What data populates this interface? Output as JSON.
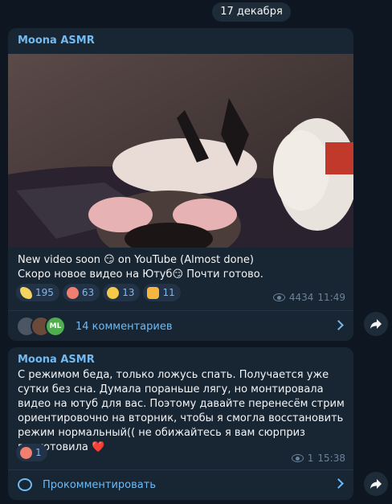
{
  "date_separator": "17 декабря",
  "messages": [
    {
      "author": "Moona ASMR",
      "text": "New video soon 😏 on YouTube (Almost done)\nСкоро новое видео на Ютуб😏 Почти готово.",
      "reactions": [
        {
          "icon": "banana-emoji",
          "count": "195"
        },
        {
          "icon": "heart-face-emoji",
          "count": "63"
        },
        {
          "icon": "grin-emoji",
          "count": "13"
        },
        {
          "icon": "ok-hand-emoji",
          "count": "11"
        }
      ],
      "views": "4434",
      "time": "11:49",
      "avatars": [
        "",
        "",
        "ML"
      ],
      "comments_label": "14 комментариев"
    },
    {
      "author": "Moona ASMR",
      "text": "С режимом беда, только ложусь спать. Получается уже сутки без сна. Думала пораньше лягу, но монтировала видео на ютуб для вас. Поэтому давайте перенесём стрим ориентировочно на вторник, чтобы я смогла восстановить режим нормальный(( не обижайтесь я вам сюрприз приготовила ❤️",
      "reactions": [
        {
          "icon": "heart-face-emoji",
          "count": "1"
        }
      ],
      "views": "1",
      "time": "15:38",
      "comments_label": "Прокомментировать"
    }
  ],
  "colors": {
    "background": "#0e1621",
    "bubble": "#182533",
    "accent": "#71baf2",
    "meta": "#6b8299"
  }
}
